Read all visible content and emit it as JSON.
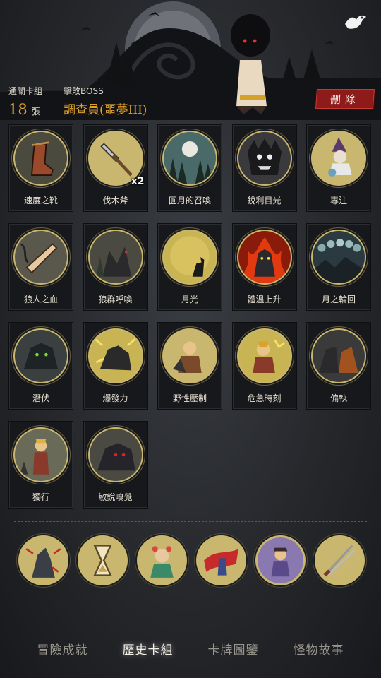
{
  "header": {
    "cleared_decks_label": "通關卡組",
    "cleared_decks_count": "18",
    "cleared_decks_unit": "張",
    "boss_label": "擊敗BOSS",
    "boss_name": "調查員(噩夢III)",
    "delete_label": "刪除"
  },
  "cards": [
    {
      "name": "速度之靴",
      "icon": "boot-icon",
      "badge": ""
    },
    {
      "name": "伐木斧",
      "icon": "axe-icon",
      "badge": "x2"
    },
    {
      "name": "圓月的召喚",
      "icon": "full-moon-forest-icon",
      "badge": ""
    },
    {
      "name": "銳利目光",
      "icon": "werewolf-face-icon",
      "badge": ""
    },
    {
      "name": "專注",
      "icon": "witch-icon",
      "badge": ""
    },
    {
      "name": "狼人之血",
      "icon": "transforming-arm-icon",
      "badge": ""
    },
    {
      "name": "狼群呼喚",
      "icon": "wolf-pack-icon",
      "badge": ""
    },
    {
      "name": "月光",
      "icon": "howling-moon-icon",
      "badge": ""
    },
    {
      "name": "體溫上升",
      "icon": "fire-werewolf-icon",
      "badge": ""
    },
    {
      "name": "月之輪回",
      "icon": "moon-phases-icon",
      "badge": ""
    },
    {
      "name": "潛伏",
      "icon": "lurking-wolf-icon",
      "badge": ""
    },
    {
      "name": "爆發力",
      "icon": "burst-wolf-icon",
      "badge": ""
    },
    {
      "name": "野性壓制",
      "icon": "wild-suppress-icon",
      "badge": ""
    },
    {
      "name": "危急時刻",
      "icon": "crisis-boy-icon",
      "badge": ""
    },
    {
      "name": "偏執",
      "icon": "bear-wolf-icon",
      "badge": ""
    },
    {
      "name": "獨行",
      "icon": "lone-boy-icon",
      "badge": ""
    },
    {
      "name": "敏銳嗅覺",
      "icon": "sniffing-wolf-icon",
      "badge": ""
    }
  ],
  "relics": [
    {
      "icon": "howling-wolf-relic-icon"
    },
    {
      "icon": "hourglass-relic-icon"
    },
    {
      "icon": "flower-girl-relic-icon"
    },
    {
      "icon": "caped-hero-relic-icon"
    },
    {
      "icon": "bandit-relic-icon"
    },
    {
      "icon": "blades-relic-icon"
    }
  ],
  "tabs": [
    {
      "label": "冒險成就",
      "active": false
    },
    {
      "label": "歷史卡組",
      "active": true
    },
    {
      "label": "卡牌圖鑒",
      "active": false
    },
    {
      "label": "怪物故事",
      "active": false
    }
  ],
  "colors": {
    "accent_gold": "#e0a12a",
    "card_ring": "#c9b770",
    "delete_red": "#8e1a1a"
  }
}
